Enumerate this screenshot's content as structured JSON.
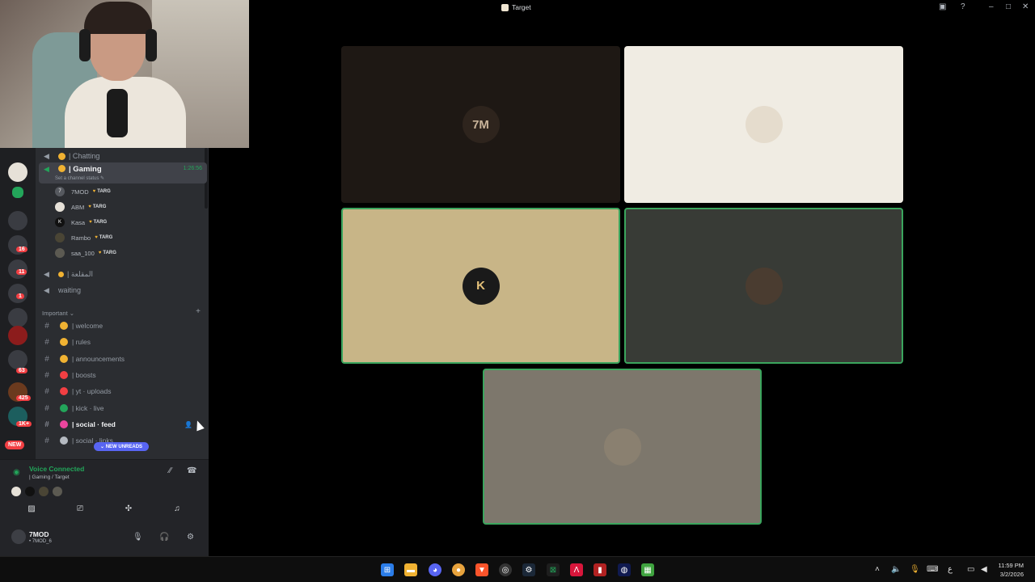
{
  "window": {
    "title": "Target"
  },
  "voice_channels": [
    {
      "name": "| Chatting",
      "active": false
    },
    {
      "name": "| Gaming",
      "active": true,
      "timer": "1:26:56",
      "status": "Set a channel status ✎"
    }
  ],
  "gaming_members": [
    {
      "name": "7MOD",
      "tag": "TARG"
    },
    {
      "name": "ABM",
      "tag": "TARG"
    },
    {
      "name": "Kasa",
      "tag": "TARG"
    },
    {
      "name": "Rambo",
      "tag": "TARG"
    },
    {
      "name": "saa_100",
      "tag": "TARG"
    }
  ],
  "other_voice": [
    {
      "name": "| المقلعة"
    },
    {
      "name": "waiting"
    }
  ],
  "category": {
    "name": "Important ⌄"
  },
  "text_channels": [
    {
      "name": "| welcome",
      "emoji_color": "#f0b232"
    },
    {
      "name": "| rules",
      "emoji_color": "#f0b232"
    },
    {
      "name": "| announcements",
      "emoji_color": "#f0b232"
    },
    {
      "name": "| boosts",
      "emoji_color": "#f23f43"
    },
    {
      "name": "| yt · uploads",
      "emoji_color": "#f23f43"
    },
    {
      "name": "| kick · live",
      "emoji_color": "#23a55a"
    },
    {
      "name": "| social · feed",
      "emoji_color": "#eb459e",
      "bold": true
    },
    {
      "name": "| social · links",
      "emoji_color": "#b5bac1"
    }
  ],
  "new_unreads": "⌄ NEW UNREADS",
  "server_badges": [
    "16",
    "11",
    "1",
    "63",
    "425",
    "1K+"
  ],
  "server_new": "NEW",
  "voice_panel": {
    "status": "Voice Connected",
    "channel": "| Gaming / Target"
  },
  "user_panel": {
    "name": "7MOD",
    "sub": "• 7MOD_6"
  },
  "stage_tiles": [
    {
      "label": "7M",
      "bg": "#1e1814",
      "av_bg": "#2e241d",
      "av_color": "#c8b39a",
      "speaking": false
    },
    {
      "label": "",
      "bg": "#f0ece3",
      "av_bg": "#e5dccd",
      "av_color": "#333",
      "speaking": false
    },
    {
      "label": "K",
      "bg": "#c8b587",
      "av_bg": "#1a1a1a",
      "av_color": "#e6c27a",
      "speaking": true
    },
    {
      "label": "",
      "bg": "#383b36",
      "av_bg": "#4a3c30",
      "av_color": "#fff",
      "speaking": true
    },
    {
      "label": "",
      "bg": "#7d776c",
      "av_bg": "#8a8070",
      "av_color": "#fff",
      "speaking": true
    }
  ],
  "clock": {
    "time": "11:59 PM",
    "date": "3/2/2026"
  },
  "tray_lang": "ع"
}
